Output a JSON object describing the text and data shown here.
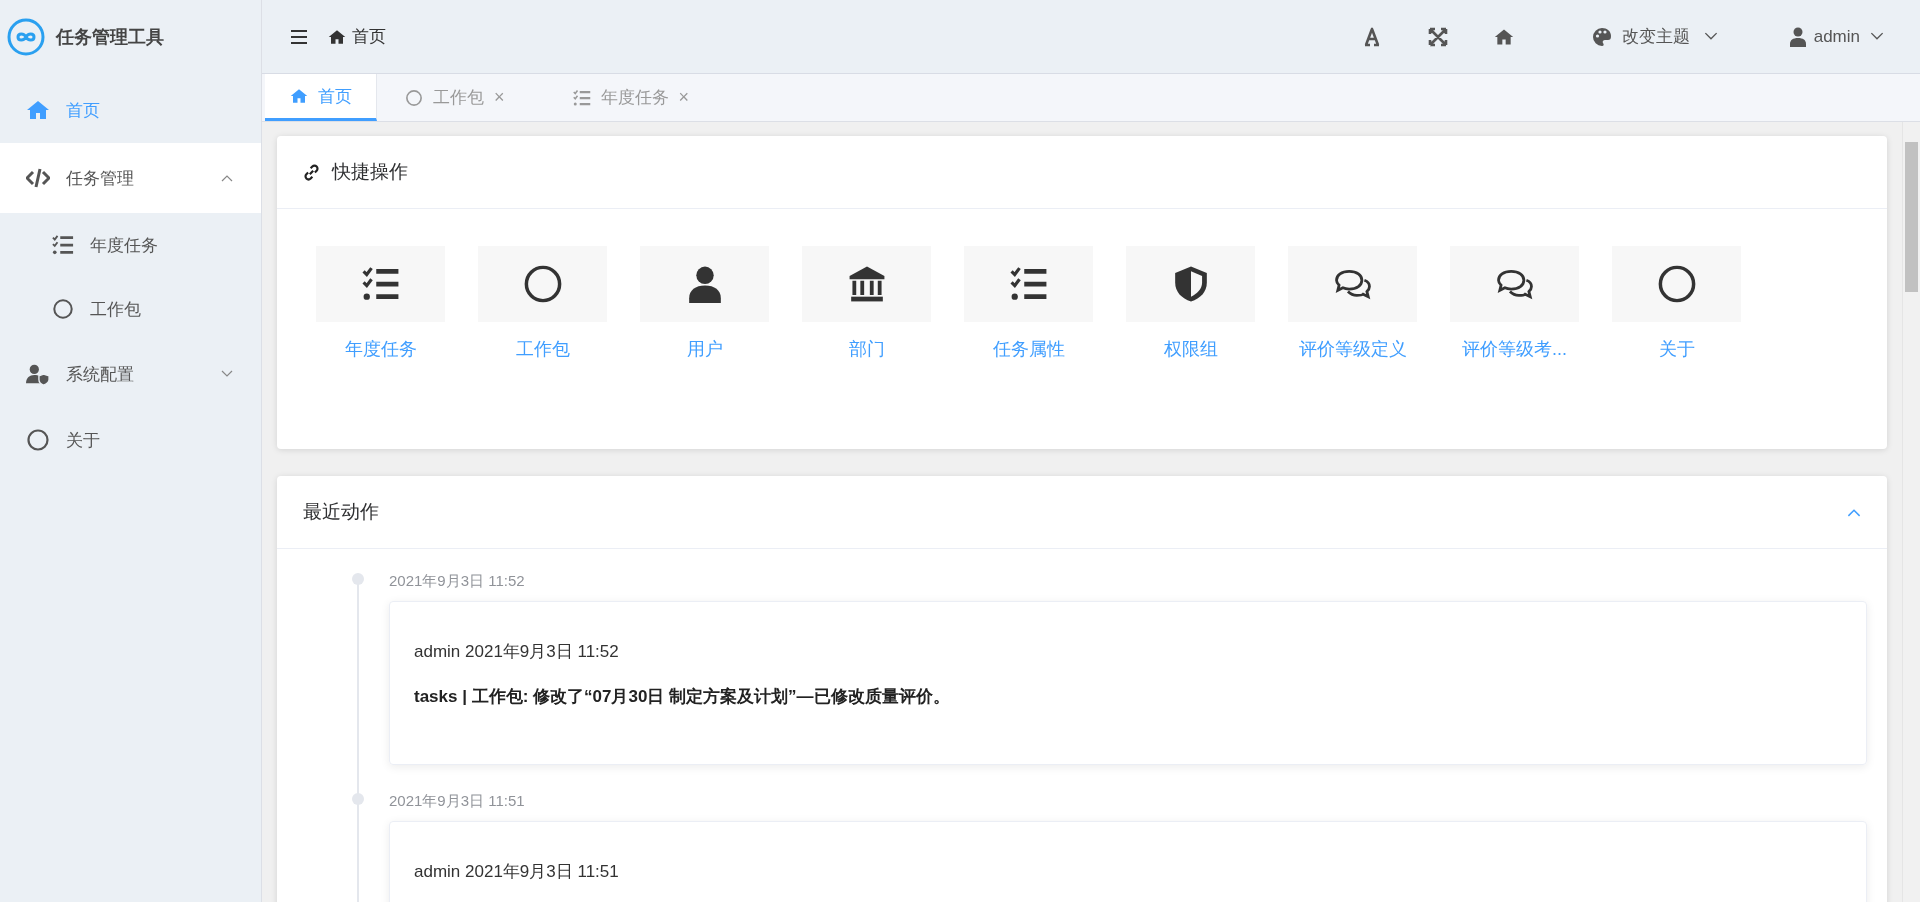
{
  "app": {
    "title": "任务管理工具"
  },
  "sidebar": {
    "items": [
      {
        "label": "首页",
        "kind": "home",
        "selected": true
      },
      {
        "label": "任务管理",
        "kind": "code",
        "selected": false,
        "expanded": true,
        "children": [
          {
            "label": "年度任务",
            "kind": "tasks",
            "selected": false
          },
          {
            "label": "工作包",
            "kind": "circle",
            "selected": false
          }
        ]
      },
      {
        "label": "系统配置",
        "kind": "user-shield",
        "selected": false,
        "expanded": false
      },
      {
        "label": "关于",
        "kind": "circle",
        "selected": false
      }
    ]
  },
  "header": {
    "breadcrumb": "首页",
    "theme": "改变主题",
    "user": "admin"
  },
  "tabs": [
    {
      "label": "首页",
      "kind": "home",
      "selected": true
    },
    {
      "label": "工作包",
      "kind": "circle",
      "selected": false,
      "close": "×"
    },
    {
      "label": "年度任务",
      "kind": "tasks",
      "selected": false,
      "close": "×"
    }
  ],
  "quick_actions": {
    "title": "快捷操作",
    "items": [
      {
        "label": "年度任务",
        "kind": "tasks"
      },
      {
        "label": "工作包",
        "kind": "circle"
      },
      {
        "label": "用户",
        "kind": "user"
      },
      {
        "label": "部门",
        "kind": "bank"
      },
      {
        "label": "任务属性",
        "kind": "tasks"
      },
      {
        "label": "权限组",
        "kind": "shield"
      },
      {
        "label": "评价等级定义",
        "kind": "comments"
      },
      {
        "label": "评价等级考...",
        "kind": "comments"
      },
      {
        "label": "关于",
        "kind": "circle"
      }
    ]
  },
  "recent": {
    "title": "最近动作",
    "expanded": true,
    "entries": [
      {
        "time": "2021年9月3日 11:52",
        "header": "admin 2021年9月3日 11:52",
        "message": "tasks | 工作包: 修改了“07月30日 制定方案及计划”—已修改质量评价。"
      },
      {
        "time": "2021年9月3日 11:51",
        "header": "admin 2021年9月3日 11:51"
      }
    ]
  }
}
